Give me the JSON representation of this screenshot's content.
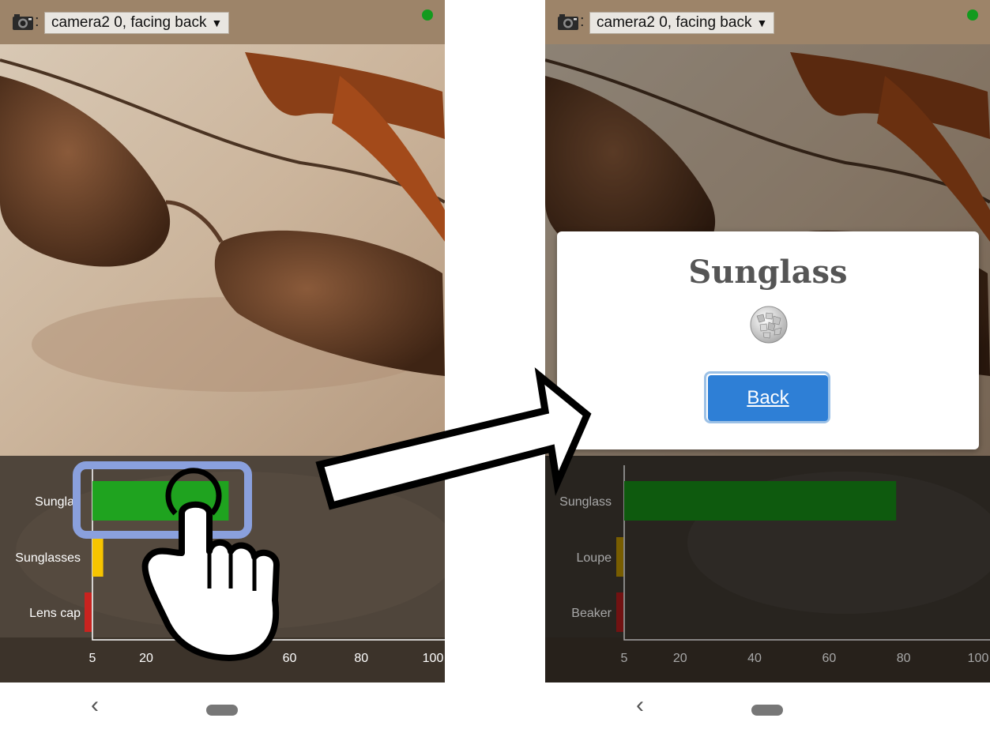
{
  "camera": {
    "label": "camera2 0, facing back",
    "separator": ":",
    "dropdown_arrow": "▼"
  },
  "left_screen": {
    "chart_data": {
      "type": "bar",
      "categories": [
        "Sunglass",
        "Sunglasses",
        "Lens cap"
      ],
      "values": [
        43,
        8,
        2
      ],
      "xticks": [
        5,
        20,
        60,
        80,
        100
      ],
      "xlim": [
        5,
        100
      ],
      "colors": [
        "#1fa31f",
        "#f6c400",
        "#c9231f"
      ]
    },
    "label_display": [
      "Sunglas",
      "Sunglasses",
      "Lens cap"
    ]
  },
  "right_screen": {
    "chart_data": {
      "type": "bar",
      "categories": [
        "Sunglass",
        "Loupe",
        "Beaker"
      ],
      "values": [
        78,
        2,
        2
      ],
      "xticks": [
        5,
        20,
        40,
        60,
        80,
        100
      ],
      "xlim": [
        5,
        100
      ],
      "colors": [
        "#168a16",
        "#b89000",
        "#b01c1c"
      ]
    },
    "modal": {
      "title": "Sunglass",
      "back_label": "Back"
    }
  },
  "nav": {
    "back_glyph": "‹"
  },
  "icons": [
    "camera-icon",
    "status-dot",
    "wikipedia-globe-icon",
    "tap-hand-icon",
    "arrow-right-icon"
  ]
}
